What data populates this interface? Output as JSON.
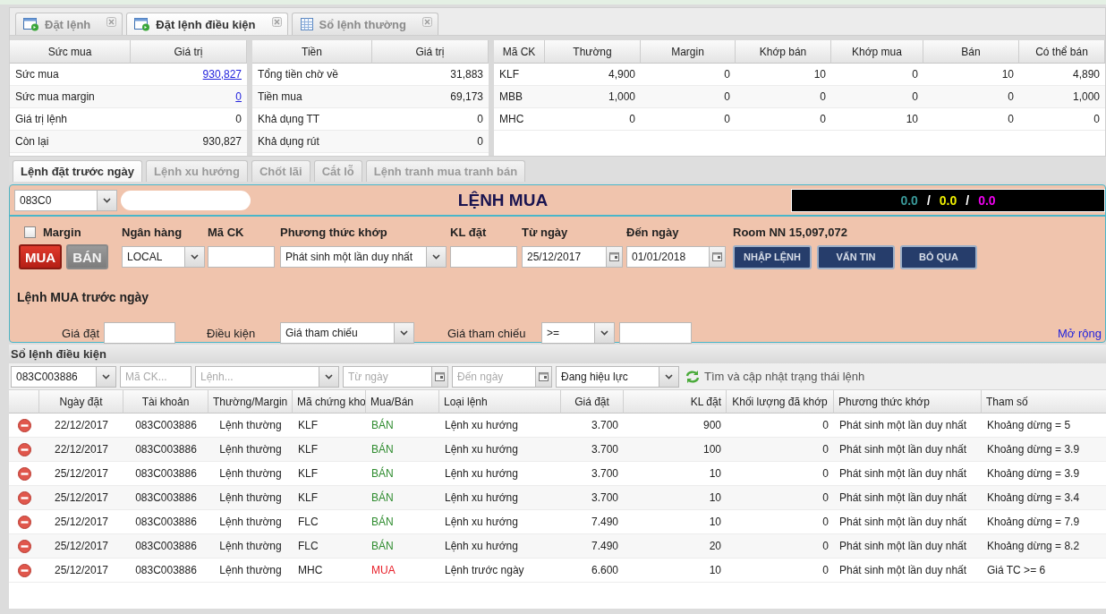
{
  "main_tabs": [
    {
      "label": "Đặt lệnh",
      "kind": "window",
      "selected": false
    },
    {
      "label": "Đặt lệnh điều kiện",
      "kind": "window",
      "selected": true
    },
    {
      "label": "Sổ lệnh thường",
      "kind": "sheet",
      "selected": false
    }
  ],
  "balance_table": {
    "columns": [
      "Sức mua",
      "Giá trị"
    ],
    "rows": [
      {
        "label": "Sức mua",
        "value": "930,827",
        "link": true
      },
      {
        "label": "Sức mua margin",
        "value": "0",
        "link": true
      },
      {
        "label": "Giá trị lệnh",
        "value": "0",
        "link": false
      },
      {
        "label": "Còn lại",
        "value": "930,827",
        "link": false
      }
    ]
  },
  "cash_table": {
    "columns": [
      "Tiền",
      "Giá trị"
    ],
    "rows": [
      [
        "Tổng tiền chờ về",
        "31,883"
      ],
      [
        "Tiền mua",
        "69,173"
      ],
      [
        "Khả dụng TT",
        "0"
      ],
      [
        "Khả dụng rút",
        "0"
      ]
    ]
  },
  "holdings_table": {
    "columns": [
      "Mã CK",
      "Thường",
      "Margin",
      "Khớp bán",
      "Khớp mua",
      "Bán",
      "Có thể bán"
    ],
    "rows": [
      [
        "KLF",
        "4,900",
        "0",
        "10",
        "0",
        "10",
        "4,890"
      ],
      [
        "MBB",
        "1,000",
        "0",
        "0",
        "0",
        "0",
        "1,000"
      ],
      [
        "MHC",
        "0",
        "0",
        "0",
        "10",
        "0",
        "0"
      ]
    ]
  },
  "order_tabs": [
    {
      "label": "Lệnh đặt trước ngày",
      "selected": true
    },
    {
      "label": "Lệnh xu hướng",
      "selected": false
    },
    {
      "label": "Chốt lãi",
      "selected": false
    },
    {
      "label": "Cắt lỗ",
      "selected": false
    },
    {
      "label": "Lệnh tranh mua tranh bán",
      "selected": false
    }
  ],
  "order_form": {
    "account": {
      "kind": "select",
      "value": "083C0"
    },
    "title": "LỆNH MUA",
    "ticker": [
      {
        "kind": "value",
        "text": "0.0",
        "color": "#3a9a9a"
      },
      {
        "kind": "separator",
        "text": "/"
      },
      {
        "kind": "value",
        "text": "0.0",
        "color": "#f0f000"
      },
      {
        "kind": "separator",
        "text": "/"
      },
      {
        "kind": "value",
        "text": "0.0",
        "color": "#f000f0"
      }
    ],
    "margin": {
      "label": "Margin",
      "checked": false
    },
    "sides": [
      {
        "label": "MUA",
        "selected": true
      },
      {
        "label": "BÁN",
        "selected": false
      }
    ],
    "fields": [
      {
        "label": "Ngân hàng",
        "kind": "select",
        "value": "LOCAL"
      },
      {
        "label": "Mã CK",
        "kind": "text"
      },
      {
        "label": "Phương thức khớp",
        "kind": "select",
        "value": "Phát sinh một lần duy nhất"
      },
      {
        "label": "KL đặt",
        "kind": "text"
      },
      {
        "label": "Từ ngày",
        "kind": "date",
        "value": "25/12/2017"
      },
      {
        "label": "Đến ngày",
        "kind": "date",
        "value": "01/01/2018"
      }
    ],
    "room": "Room NN 15,097,072",
    "buttons": [
      "NHẬP LỆNH",
      "VẤN TIN",
      "BỎ QUA"
    ],
    "subtitle": "Lệnh MUA trước ngày",
    "conditions": [
      {
        "label": "Giá đặt",
        "kind": "text"
      },
      {
        "label": "Điều kiện",
        "kind": "select",
        "value": "Giá tham chiếu"
      },
      {
        "label": "Giá tham chiếu",
        "kind": "select",
        "value": ">="
      },
      {
        "kind": "text"
      }
    ],
    "expand_link": "Mở rộng"
  },
  "orders": {
    "title": "Sổ lệnh điều kiện",
    "filters": [
      {
        "kind": "select",
        "value": "083C003886"
      },
      {
        "kind": "text",
        "placeholder": "Mã CK..."
      },
      {
        "kind": "select",
        "placeholder": "Lệnh..."
      },
      {
        "kind": "date",
        "placeholder": "Từ ngày"
      },
      {
        "kind": "date",
        "placeholder": "Đến ngày"
      },
      {
        "kind": "select",
        "value": "Đang hiệu lực"
      }
    ],
    "refresh_label": "Tìm và cập nhật trạng thái lệnh",
    "columns": [
      "Ngày đặt",
      "Tài khoản",
      "Thường/Margin",
      "Mã chứng kho",
      "Mua/Bán",
      "Loại lệnh",
      "Giá đặt",
      "KL đặt",
      "Khối lượng đã khớp",
      "Phương thức khớp",
      "Tham số"
    ],
    "rows": [
      {
        "cells": [
          "22/12/2017",
          "083C003886",
          "Lệnh thường",
          "KLF",
          "BÁN",
          "Lệnh xu hướng",
          "3.700",
          "900",
          "0",
          "Phát sinh một lần duy nhất",
          "Khoảng dừng = 5"
        ],
        "color": "#2e8b2e"
      },
      {
        "cells": [
          "22/12/2017",
          "083C003886",
          "Lệnh thường",
          "KLF",
          "BÁN",
          "Lệnh xu hướng",
          "3.700",
          "100",
          "0",
          "Phát sinh một lần duy nhất",
          "Khoảng dừng = 3.9"
        ],
        "color": "#2e8b2e"
      },
      {
        "cells": [
          "25/12/2017",
          "083C003886",
          "Lệnh thường",
          "KLF",
          "BÁN",
          "Lệnh xu hướng",
          "3.700",
          "10",
          "0",
          "Phát sinh một lần duy nhất",
          "Khoảng dừng = 3.9"
        ],
        "color": "#2e8b2e"
      },
      {
        "cells": [
          "25/12/2017",
          "083C003886",
          "Lệnh thường",
          "KLF",
          "BÁN",
          "Lệnh xu hướng",
          "3.700",
          "10",
          "0",
          "Phát sinh một lần duy nhất",
          "Khoảng dừng = 3.4"
        ],
        "color": "#2e8b2e"
      },
      {
        "cells": [
          "25/12/2017",
          "083C003886",
          "Lệnh thường",
          "FLC",
          "BÁN",
          "Lệnh xu hướng",
          "7.490",
          "10",
          "0",
          "Phát sinh một lần duy nhất",
          "Khoảng dừng = 7.9"
        ],
        "color": "#2e8b2e"
      },
      {
        "cells": [
          "25/12/2017",
          "083C003886",
          "Lệnh thường",
          "FLC",
          "BÁN",
          "Lệnh xu hướng",
          "7.490",
          "20",
          "0",
          "Phát sinh một lần duy nhất",
          "Khoảng dừng = 8.2"
        ],
        "color": "#2e8b2e"
      },
      {
        "cells": [
          "25/12/2017",
          "083C003886",
          "Lệnh thường",
          "MHC",
          "MUA",
          "Lệnh trước ngày",
          "6.600",
          "10",
          "0",
          "Phát sinh một lần duy nhất",
          "Giá TC >= 6"
        ],
        "color": "#e8202a"
      }
    ]
  }
}
